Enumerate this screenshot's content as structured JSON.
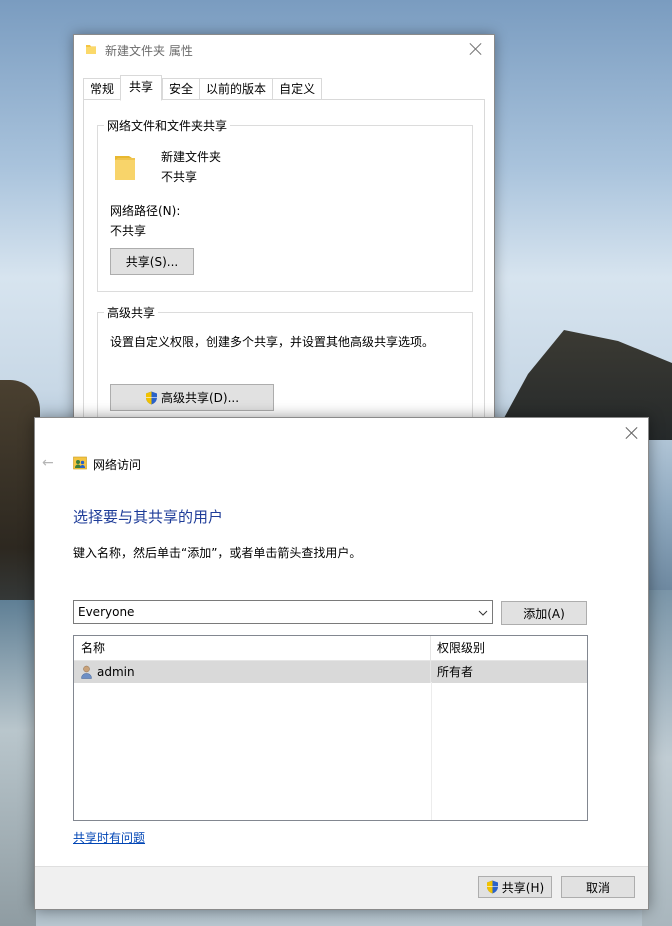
{
  "properties_window": {
    "title": "新建文件夹 属性",
    "tabs": [
      "常规",
      "共享",
      "安全",
      "以前的版本",
      "自定义"
    ],
    "active_tab": "共享",
    "network_group": {
      "label": "网络文件和文件夹共享",
      "folder_name": "新建文件夹",
      "folder_status": "不共享",
      "path_label": "网络路径(N):",
      "path_value": "不共享",
      "share_button": "共享(S)..."
    },
    "advanced_group": {
      "label": "高级共享",
      "description": "设置自定义权限，创建多个共享，并设置其他高级共享选项。",
      "button": "高级共享(D)..."
    }
  },
  "share_dialog": {
    "breadcrumb": "网络访问",
    "heading": "选择要与其共享的用户",
    "instruction": "键入名称，然后单击“添加”，或者单击箭头查找用户。",
    "combo_value": "Everyone",
    "add_button": "添加(A)",
    "columns": [
      "名称",
      "权限级别"
    ],
    "rows": [
      {
        "name": "admin",
        "permission": "所有者"
      }
    ],
    "help_link": "共享时有问题",
    "share_button": "共享(H)",
    "cancel_button": "取消"
  },
  "colors": {
    "heading": "#1f3d99",
    "link": "#0045b5",
    "selected_row": "#d9d9d9"
  }
}
